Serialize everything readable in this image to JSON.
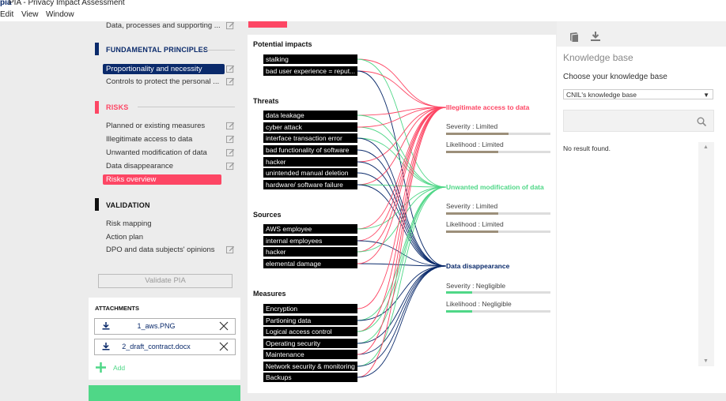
{
  "window": {
    "title": "PIA - Privacy Impact Assessment",
    "logo_text": "pia"
  },
  "menu": [
    "Edit",
    "View",
    "Window"
  ],
  "sidebar": {
    "top_item": "Data, processes and supporting ...",
    "fundamental": {
      "title": "FUNDAMENTAL PRINCIPLES",
      "items": [
        "Proportionality and necessity",
        "Controls to protect the personal ..."
      ]
    },
    "risks": {
      "title": "RISKS",
      "items": [
        "Planned or existing measures",
        "Illegitimate access to data",
        "Unwanted modification of data",
        "Data disappearance",
        "Risks overview"
      ]
    },
    "validation": {
      "title": "VALIDATION",
      "items": [
        "Risk mapping",
        "Action plan",
        "DPO and data subjects' opinions"
      ]
    },
    "validate_button": "Validate PIA",
    "attachments": {
      "title": "ATTACHMENTS",
      "files": [
        "1_aws.PNG",
        "2_draft_contract.docx"
      ],
      "add_label": "Add"
    }
  },
  "overview": {
    "potential_impacts": {
      "title": "Potential impacts",
      "items": [
        "stalking",
        "bad user experience = reput..."
      ]
    },
    "threats": {
      "title": "Threats",
      "items": [
        "data leakage",
        "cyber attack",
        "interface transaction error",
        "bad functionality of software",
        "hacker",
        "unintended manual deletion",
        "hardware/ software failure"
      ]
    },
    "sources": {
      "title": "Sources",
      "items": [
        "AWS employee",
        "internal employees",
        "hacker",
        "elemental damage"
      ]
    },
    "measures": {
      "title": "Measures",
      "items": [
        "Encryption",
        "Partioning data",
        "Logical access control",
        "Operating security",
        "Maintenance",
        "Network security & monitoring",
        "Backups"
      ]
    },
    "risks": [
      {
        "title": "Illegitimate access to data",
        "color": "#fd4664",
        "severity": "Severity : Limited",
        "likelihood": "Likelihood : Limited",
        "severity_level": 0.6,
        "likelihood_level": 0.5
      },
      {
        "title": "Unwanted modification of data",
        "color": "#4fd787",
        "severity": "Severity : Limited",
        "likelihood": "Likelihood : Limited",
        "severity_level": 0.5,
        "likelihood_level": 0.5
      },
      {
        "title": "Data disappearance",
        "color": "#0a2a6b",
        "severity": "Severity : Negligible",
        "likelihood": "Likelihood : Negligible",
        "severity_level": 0.25,
        "likelihood_level": 0.25
      }
    ]
  },
  "knowledge_base": {
    "title": "Knowledge base",
    "choose_label": "Choose your knowledge base",
    "selected": "CNIL's knowledge base",
    "search_placeholder": "",
    "no_result": "No result found."
  },
  "colors": {
    "accent_red": "#fd4664",
    "accent_green": "#4fd787",
    "navy": "#0a2a6b",
    "meter_brown": "#9c8f7a"
  }
}
